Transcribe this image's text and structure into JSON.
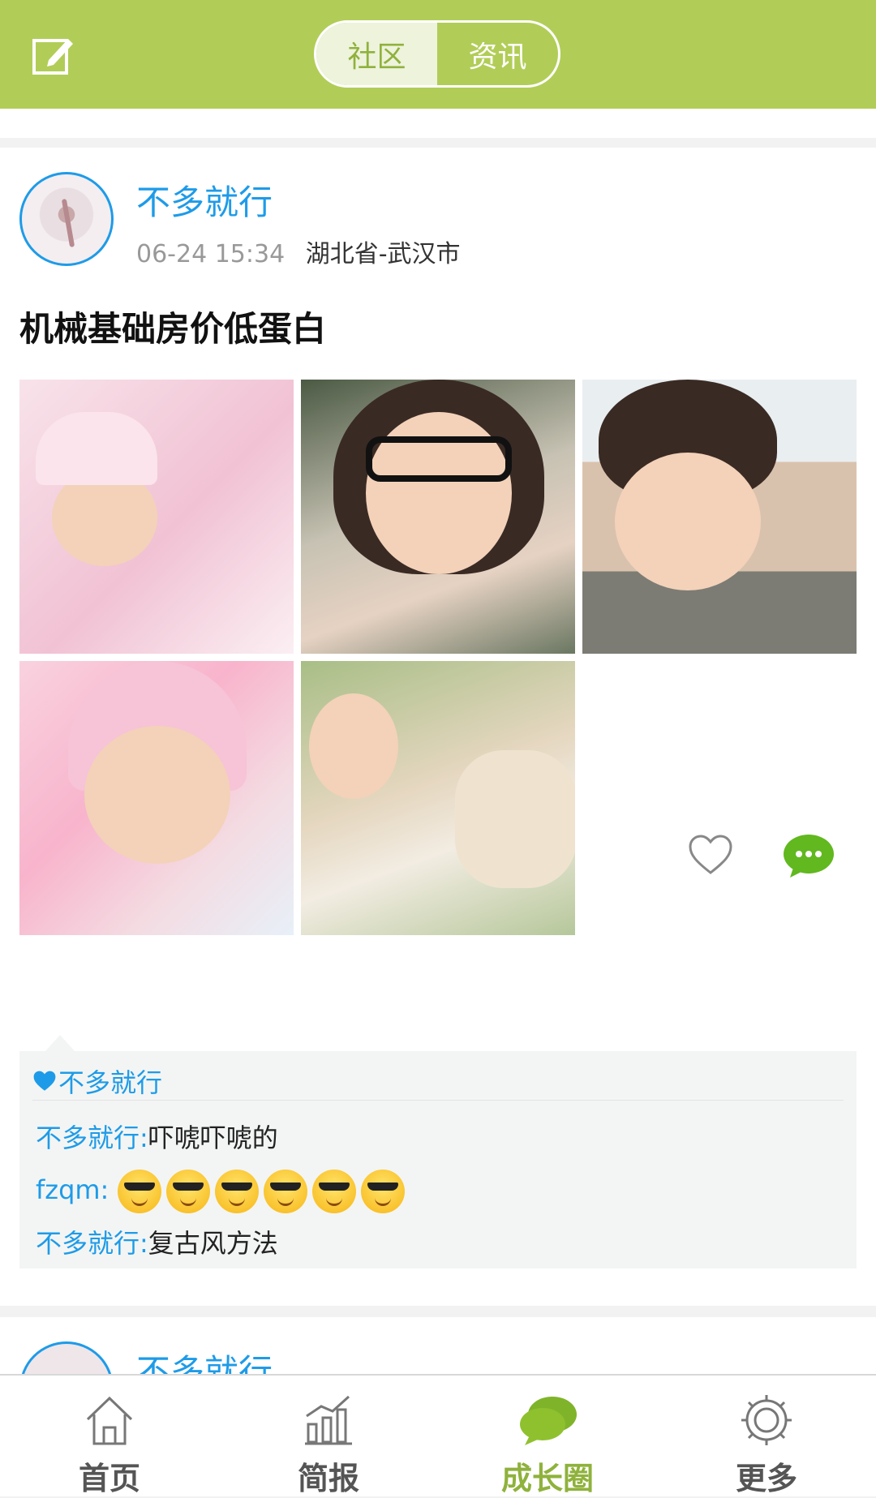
{
  "header": {
    "tabs": [
      {
        "label": "社区",
        "active": true
      },
      {
        "label": "资讯",
        "active": false
      }
    ]
  },
  "post": {
    "username": "不多就行",
    "time": "06-24 15:34",
    "location": "湖北省-武汉市",
    "text": "机械基础房价低蛋白",
    "liked_by": "不多就行",
    "comments": [
      {
        "author": "不多就行",
        "text": "吓唬吓唬的"
      },
      {
        "author": "fzqm",
        "text": ""
      },
      {
        "author": "不多就行",
        "text": "复古风方法"
      }
    ]
  },
  "next_post": {
    "username": "不多就行"
  },
  "tabbar": {
    "items": [
      {
        "label": "首页"
      },
      {
        "label": "简报"
      },
      {
        "label": "成长圈",
        "active": true
      },
      {
        "label": "更多"
      }
    ]
  },
  "colors": {
    "header": "#b1cd57",
    "accent_blue": "#1e9be8",
    "accent_green": "#8fb23c"
  }
}
